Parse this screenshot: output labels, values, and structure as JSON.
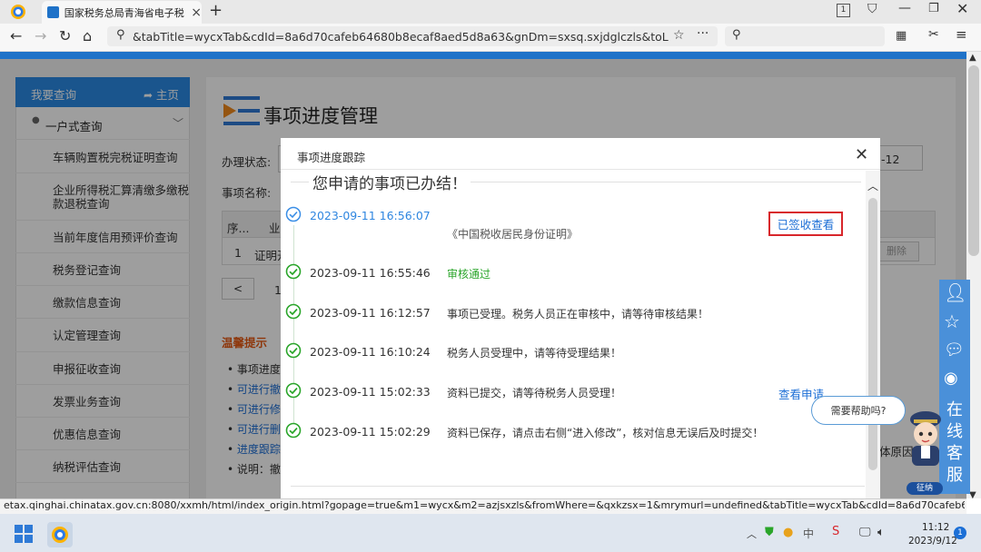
{
  "browser": {
    "tab_title": "国家税务总局青海省电子税",
    "url": "&tabTitle=wycxTab&cdId=8a6d70cafeb64680b8ecaf8aed5d8a63&gnDm=sxsq.sxjdglczls&toLogin=null",
    "status_url": "etax.qinghai.chinatax.gov.cn:8080/xxmh/html/index_origin.html?gopage=true&m1=wycx&m2=azjsxzls&fromWhere=&qxkzsx=1&mrymurl=undefined&tabTitle=wycxTab&cdId=8a6d70cafeb64680b8ecaf8aed5d8a..."
  },
  "sidebar": {
    "title": "我要查询",
    "home": "主页",
    "group": "一户式查询",
    "items": [
      "车辆购置税完税证明查询",
      "企业所得税汇算清缴多缴税款退税查询",
      "当前年度信用预评价查询",
      "税务登记查询",
      "缴款信息查询",
      "认定管理查询",
      "申报征收查询",
      "发票业务查询",
      "优惠信息查询",
      "纳税评估查询"
    ]
  },
  "main": {
    "title": "事项进度管理",
    "status_label": "办理状态:",
    "name_label": "事项名称:",
    "date_fragment": "-12",
    "col_index": "序...",
    "col_business": "业",
    "row_index": "1",
    "row_name": "证明开",
    "delete_button": "删除",
    "page_prev": "<",
    "page_num": "1",
    "warm_tips": "温馨提示",
    "tips": [
      "事项进度",
      "可进行撤",
      "可进行修",
      "可进行删",
      "进度跟踪",
      "说明：撤"
    ],
    "right_fragment": "体原因"
  },
  "modal": {
    "title": "事项进度跟踪",
    "heading": "您申请的事项已办结！",
    "events": [
      {
        "time": "2023-09-11 16:56:07",
        "desc": "《中国税收居民身份证明》",
        "action": "已签收查看"
      },
      {
        "time": "2023-09-11 16:55:46",
        "desc": "审核通过",
        "action": ""
      },
      {
        "time": "2023-09-11 16:12:57",
        "desc": "事项已受理。税务人员正在审核中，请等待审核结果！",
        "action": ""
      },
      {
        "time": "2023-09-11 16:10:24",
        "desc": "税务人员受理中，请等待受理结果！",
        "action": ""
      },
      {
        "time": "2023-09-11 15:02:33",
        "desc": "资料已提交，请等待税务人员受理！",
        "action": "查看申请"
      },
      {
        "time": "2023-09-11 15:02:29",
        "desc": "资料已保存，请点击右侧“进入修改”，核对信息无误后及时提交！",
        "action": ""
      }
    ]
  },
  "widgets": {
    "help_bubble": "需要帮助吗?",
    "online_service": "在线客服",
    "badge": "征纳"
  },
  "taskbar": {
    "time": "11:12",
    "date": "2023/9/12",
    "notifications": "1"
  },
  "colors": {
    "accent": "#2a8ae4",
    "success": "#2aa52a",
    "link": "#1d6fd6",
    "highlight_box": "#d8262b",
    "warm": "#e65a14"
  }
}
